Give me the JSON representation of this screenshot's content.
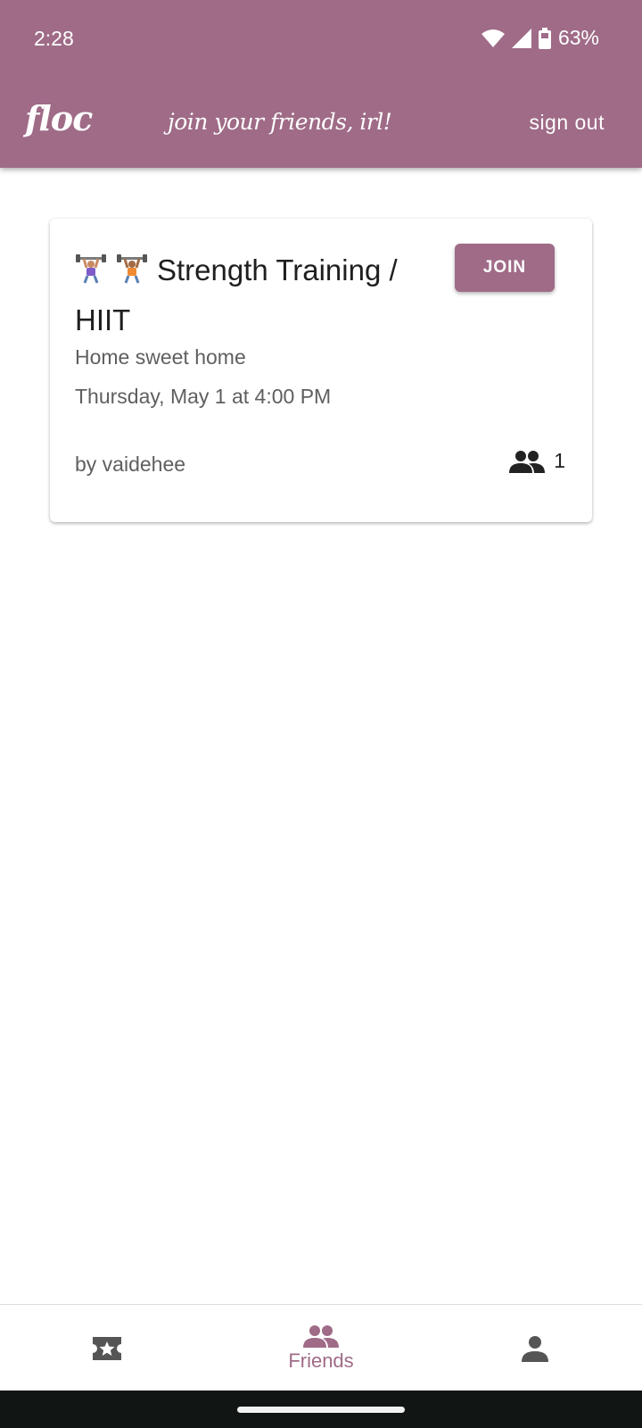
{
  "status_bar": {
    "time": "2:28",
    "battery": "63%"
  },
  "header": {
    "brand": "floc",
    "tagline": "join your friends, irl!",
    "sign_out_label": "sign out"
  },
  "event": {
    "title": "Strength Training / HIIT",
    "join_label": "JOIN",
    "location": "Home sweet home",
    "datetime": "Thursday, May 1 at 4:00 PM",
    "host": "by vaidehee",
    "attendee_count": "1",
    "icons": [
      "weight-lifter-emoji",
      "weight-lifter-emoji",
      "people-icon"
    ]
  },
  "bottom_nav": {
    "items": [
      {
        "icon": "ticket-star-icon",
        "label": ""
      },
      {
        "icon": "people-icon",
        "label": "Friends",
        "active": true
      },
      {
        "icon": "person-icon",
        "label": ""
      }
    ]
  },
  "colors": {
    "accent": "#9f6b87",
    "nav_inactive": "#555555"
  }
}
